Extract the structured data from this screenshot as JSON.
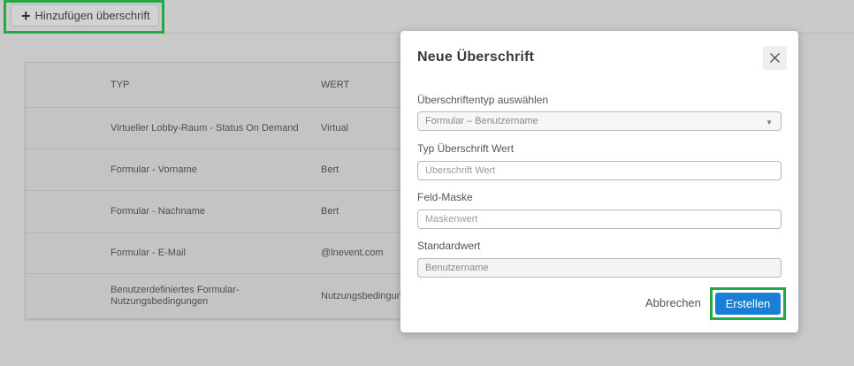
{
  "toolbar": {
    "add_heading_label": "Hinzufügen überschrift"
  },
  "table": {
    "columns": [
      "TYP",
      "WERT"
    ],
    "rows": [
      {
        "typ": "Virtueller Lobby-Raum - Status On Demand",
        "wert": "Virtual"
      },
      {
        "typ": "Formular - Vorname",
        "wert": "Bert"
      },
      {
        "typ": "Formular - Nachname",
        "wert": "Bert"
      },
      {
        "typ": "Formular - E-Mail",
        "wert": "@lnevent.com"
      },
      {
        "typ": "Benutzerdefiniertes Formular-Nutzungsbedingungen",
        "wert": "Nutzungsbedingungen"
      }
    ]
  },
  "modal": {
    "title": "Neue Überschrift",
    "heading_type_label": "Überschriftentyp auswählen",
    "heading_type_value": "Formular – Benutzername",
    "value_label": "Typ Überschrift Wert",
    "value_placeholder": "Überschrift Wert",
    "mask_label": "Feld-Maske",
    "mask_placeholder": "Maskenwert",
    "default_label": "Standardwert",
    "default_value": "Benutzername",
    "cancel_label": "Abbrechen",
    "create_label": "Erstellen"
  },
  "colors": {
    "primary": "#1a7fd4",
    "highlight": "#26a844"
  },
  "icons": {
    "add": "plus-icon",
    "close": "close-icon",
    "dropdown": "chevron-down-icon"
  }
}
